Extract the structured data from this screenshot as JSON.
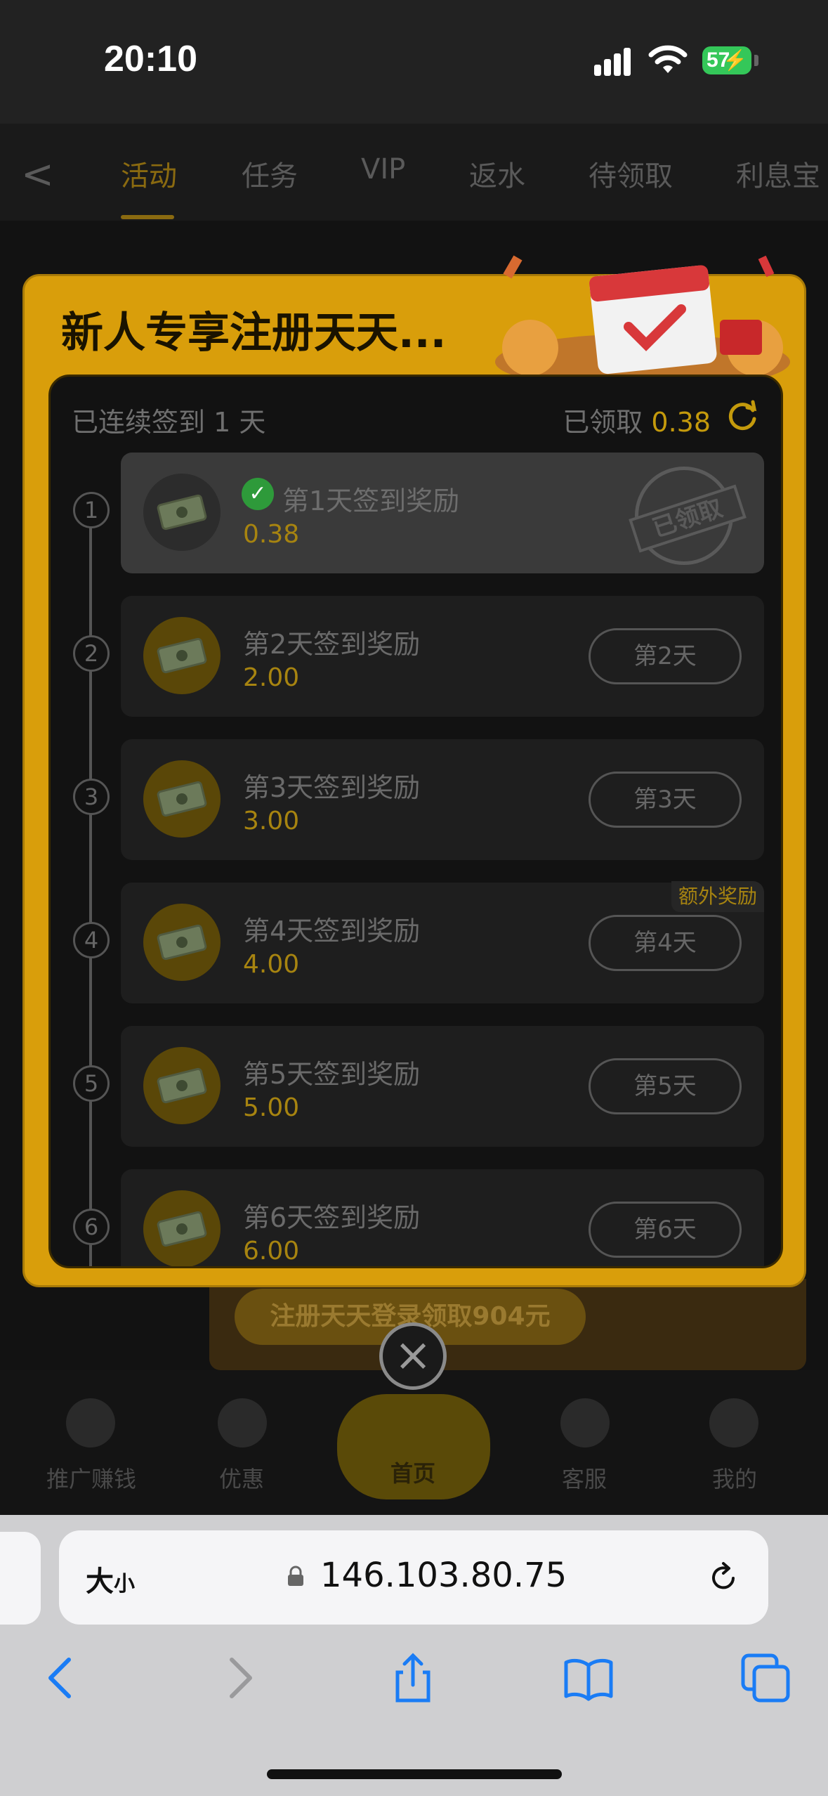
{
  "status_bar": {
    "time": "20:10",
    "battery": "57"
  },
  "background_page": {
    "back": "<",
    "tabs": [
      "活动",
      "任务",
      "VIP",
      "返水",
      "待领取",
      "利息宝"
    ],
    "banner_text": "注册天天登录领取904元",
    "bottom_nav": {
      "promote": "推广赚钱",
      "offers": "优惠",
      "home": "首页",
      "support": "客服",
      "mine": "我的"
    }
  },
  "modal": {
    "title": "新人专享注册天天...",
    "streak_text": "已连续签到  1 天",
    "claimed_label": "已领取",
    "claimed_amount": "0.38",
    "extra_reward_tag": "额外奖励",
    "stamp_text": "已领取",
    "days": [
      {
        "num": "1",
        "title": "第1天签到奖励",
        "amount": "0.38",
        "button": ""
      },
      {
        "num": "2",
        "title": "第2天签到奖励",
        "amount": "2.00",
        "button": "第2天"
      },
      {
        "num": "3",
        "title": "第3天签到奖励",
        "amount": "3.00",
        "button": "第3天"
      },
      {
        "num": "4",
        "title": "第4天签到奖励",
        "amount": "4.00",
        "button": "第4天"
      },
      {
        "num": "5",
        "title": "第5天签到奖励",
        "amount": "5.00",
        "button": "第5天"
      },
      {
        "num": "6",
        "title": "第6天签到奖励",
        "amount": "6.00",
        "button": "第6天"
      }
    ],
    "close": "×"
  },
  "safari": {
    "text_size": "大",
    "text_size_small": "小",
    "url": "146.103.80.75"
  },
  "colors": {
    "gold": "#d99e0b",
    "amount": "#a78410",
    "check": "#2e9a3a",
    "battery": "#34c759"
  }
}
